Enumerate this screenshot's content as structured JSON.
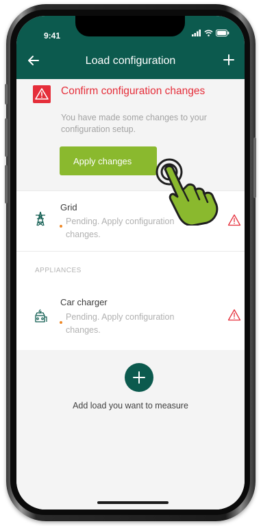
{
  "status_bar": {
    "time": "9:41"
  },
  "app_bar": {
    "title": "Load configuration",
    "back_icon": "arrow-left-icon",
    "add_icon": "plus-icon"
  },
  "alert": {
    "icon": "warning-triangle-icon",
    "title": "Confirm configuration changes",
    "message": "You have made some changes to your configuration setup.",
    "button_label": "Apply changes"
  },
  "loads": [
    {
      "name": "Grid",
      "status": "Pending. Apply configuration changes.",
      "icon": "power-pylon-icon"
    }
  ],
  "appliances_section": {
    "label": "APPLIANCES",
    "items": [
      {
        "name": "Car charger",
        "status": "Pending. Apply configuration changes.",
        "icon": "car-charger-icon"
      }
    ]
  },
  "add_load": {
    "label": "Add load you want to measure"
  },
  "colors": {
    "app_bar": "#0c5a4e",
    "alert_red": "#e52e3a",
    "button_green": "#8ab92e",
    "pending_dot": "#ef8a2a",
    "muted_text": "#a3a3a3"
  }
}
